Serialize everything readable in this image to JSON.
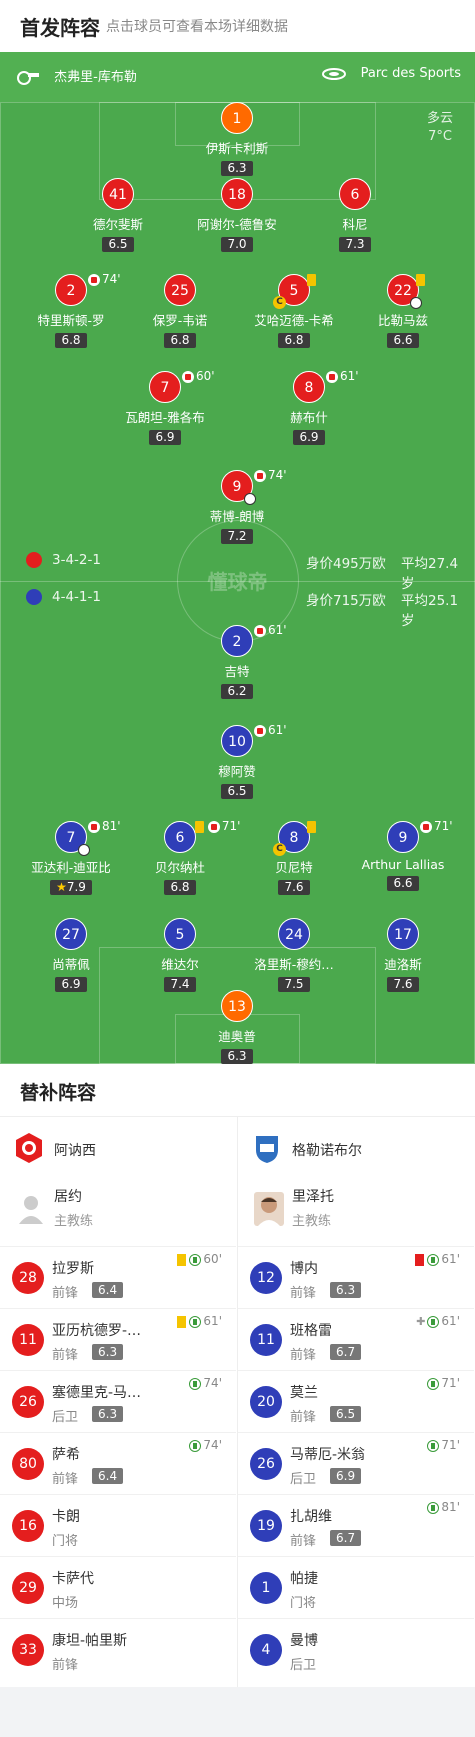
{
  "header": {
    "title": "首发阵容",
    "subtitle": "点击球员可查看本场详细数据"
  },
  "match_info": {
    "stadium": "杰弗里-库布勒",
    "venue": "Parc des Sports",
    "weather": "多云",
    "temperature": "7°C"
  },
  "pitch_watermark": "懂球帝",
  "home": {
    "formation": "3-4-2-1",
    "value": "身价495万欧",
    "age": "平均27.4岁",
    "color": "#e41e1e",
    "players": [
      {
        "num": "1",
        "name": "伊斯卡利斯",
        "rating": "6.3",
        "role": "gk"
      },
      {
        "num": "41",
        "name": "德尔斐斯",
        "rating": "6.5"
      },
      {
        "num": "18",
        "name": "阿谢尔-德鲁安",
        "rating": "7.0"
      },
      {
        "num": "6",
        "name": "科尼",
        "rating": "7.3"
      },
      {
        "num": "2",
        "name": "特里斯顿-罗",
        "rating": "6.8",
        "sub": "74'"
      },
      {
        "num": "25",
        "name": "保罗-韦诺",
        "rating": "6.8"
      },
      {
        "num": "5",
        "name": "艾哈迈德-卡希",
        "rating": "6.8",
        "captain": "C"
      },
      {
        "num": "22",
        "name": "比勒马兹",
        "rating": "6.6"
      },
      {
        "num": "7",
        "name": "瓦朗坦-雅各布",
        "rating": "6.9",
        "sub": "60'"
      },
      {
        "num": "8",
        "name": "赫布什",
        "rating": "6.9",
        "sub": "61'"
      },
      {
        "num": "9",
        "name": "蒂博-朗博",
        "rating": "7.2",
        "sub": "74'"
      }
    ]
  },
  "away": {
    "formation": "4-4-1-1",
    "value": "身价715万欧",
    "age": "平均25.1岁",
    "color": "#2f3eb8",
    "players": [
      {
        "num": "2",
        "name": "吉特",
        "rating": "6.2",
        "sub": "61'"
      },
      {
        "num": "10",
        "name": "穆阿赞",
        "rating": "6.5",
        "sub": "61'"
      },
      {
        "num": "7",
        "name": "亚达利-迪亚比",
        "rating": "7.9",
        "sub": "81'"
      },
      {
        "num": "6",
        "name": "贝尔纳杜",
        "rating": "6.8",
        "sub": "71'"
      },
      {
        "num": "8",
        "name": "贝尼特",
        "rating": "7.6",
        "captain": "C"
      },
      {
        "num": "9",
        "name": "Arthur Lallias",
        "rating": "6.6",
        "sub": "71'"
      },
      {
        "num": "27",
        "name": "尚蒂佩",
        "rating": "6.9"
      },
      {
        "num": "5",
        "name": "维达尔",
        "rating": "7.4"
      },
      {
        "num": "24",
        "name": "洛里斯-穆约…",
        "rating": "7.5"
      },
      {
        "num": "17",
        "name": "迪洛斯",
        "rating": "7.6"
      },
      {
        "num": "13",
        "name": "迪奥普",
        "rating": "6.3",
        "role": "gk"
      }
    ]
  },
  "subs": {
    "title": "替补阵容",
    "home_team": "阿讷西",
    "away_team": "格勒诺布尔",
    "home_coach": {
      "name": "居约",
      "role": "主教练"
    },
    "away_coach": {
      "name": "里泽托",
      "role": "主教练"
    },
    "home_list": [
      {
        "num": "28",
        "name": "拉罗斯",
        "pos": "前锋",
        "rating": "6.4",
        "event": "60'"
      },
      {
        "num": "11",
        "name": "亚历杭德罗-…",
        "pos": "前锋",
        "rating": "6.3",
        "event": "61'"
      },
      {
        "num": "26",
        "name": "塞德里克-马…",
        "pos": "后卫",
        "rating": "6.3",
        "event": "74'"
      },
      {
        "num": "80",
        "name": "萨希",
        "pos": "前锋",
        "rating": "6.4",
        "event": "74'"
      },
      {
        "num": "16",
        "name": "卡朗",
        "pos": "门将"
      },
      {
        "num": "29",
        "name": "卡萨代",
        "pos": "中场"
      },
      {
        "num": "33",
        "name": "康坦-帕里斯",
        "pos": "前锋"
      }
    ],
    "away_list": [
      {
        "num": "12",
        "name": "博内",
        "pos": "前锋",
        "rating": "6.3",
        "event": "61'"
      },
      {
        "num": "11",
        "name": "班格雷",
        "pos": "前锋",
        "rating": "6.7",
        "event": "61'"
      },
      {
        "num": "20",
        "name": "莫兰",
        "pos": "前锋",
        "rating": "6.5",
        "event": "71'"
      },
      {
        "num": "26",
        "name": "马蒂厄-米翁",
        "pos": "后卫",
        "rating": "6.9",
        "event": "71'"
      },
      {
        "num": "19",
        "name": "扎胡维",
        "pos": "前锋",
        "rating": "6.7",
        "event": "81'"
      },
      {
        "num": "1",
        "name": "帕捷",
        "pos": "门将"
      },
      {
        "num": "4",
        "name": "曼博",
        "pos": "后卫"
      }
    ]
  }
}
